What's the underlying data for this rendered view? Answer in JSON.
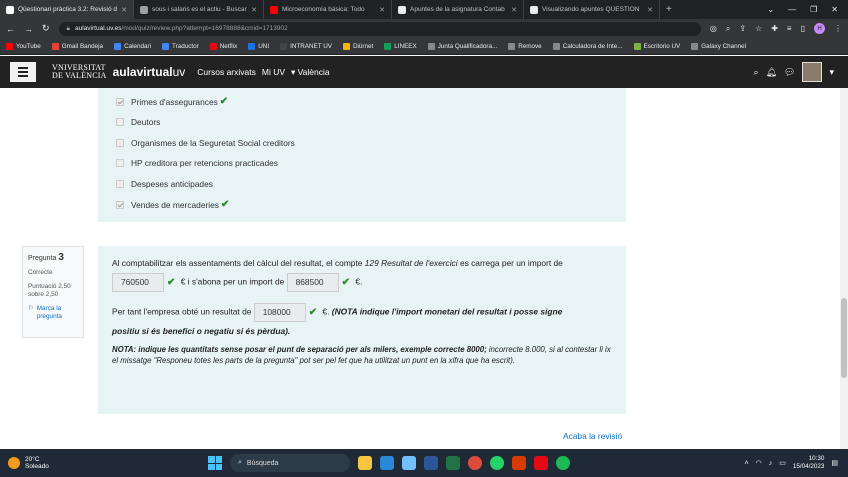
{
  "browser": {
    "tabs": [
      {
        "title": "Qüestionari pràctica 3.2: Revisió d",
        "active": true,
        "color": "#ffffff"
      },
      {
        "title": "sous i salaris es el actiu - Buscar",
        "active": false,
        "color": "#9aa0a6"
      },
      {
        "title": "Microeconomía básica: Todo",
        "active": false,
        "color": "#ff0000"
      },
      {
        "title": "Apuntes de la asignatura Contab",
        "active": false,
        "color": "#e8eaed"
      },
      {
        "title": "Visualizando apuntes QÜESTION",
        "active": false,
        "color": "#e8eaed"
      }
    ],
    "new_tab": "+",
    "window_controls": [
      "⌄",
      "—",
      "❐",
      "✕"
    ],
    "url_host": "aulavirtual.uv.es",
    "url_path": "/mod/quiz/review.php?attempt=16978888&cmid=1713902",
    "profile_initial": "H",
    "bookmarks": [
      {
        "label": "YouTube",
        "color": "#ff0000"
      },
      {
        "label": "Gmail Bandeja",
        "color": "#ea4335"
      },
      {
        "label": "Calendari",
        "color": "#4285f4"
      },
      {
        "label": "Traductor",
        "color": "#4285f4"
      },
      {
        "label": "Netflix",
        "color": "#e50914"
      },
      {
        "label": "UNI",
        "color": "#1a73e8"
      },
      {
        "label": "INTRANET UV",
        "color": "#444444"
      },
      {
        "label": "Diürnet",
        "color": "#f4b400"
      },
      {
        "label": "LINEEX",
        "color": "#0f9d58"
      },
      {
        "label": "Junta Qualificadora...",
        "color": "#888888"
      },
      {
        "label": "Remove",
        "color": "#888888"
      },
      {
        "label": "Calculadora de Inte...",
        "color": "#888888"
      },
      {
        "label": "Escritorio UV",
        "color": "#7cb342"
      },
      {
        "label": "Galaxy Channel",
        "color": "#888888"
      }
    ]
  },
  "site": {
    "logo_line1": "VNIVERSITAT",
    "logo_line2": "DE VALÈNCIA",
    "brand_bold": "aulavirtual",
    "brand_light": "uv",
    "nav": [
      "Cursos arxivats",
      "Mi UV",
      "▾ València"
    ]
  },
  "answers": [
    {
      "label": "Primes d'assegurances",
      "checked": true,
      "correct": true
    },
    {
      "label": "Deutors",
      "checked": false,
      "correct": false
    },
    {
      "label": "Organismes de la Seguretat Social creditors",
      "checked": false,
      "correct": false
    },
    {
      "label": "HP creditora per retencions practicades",
      "checked": false,
      "correct": false
    },
    {
      "label": "Despeses anticipades",
      "checked": false,
      "correct": false
    },
    {
      "label": "Vendes de mercaderies",
      "checked": true,
      "correct": true
    }
  ],
  "tick_glyph": "✔",
  "question": {
    "title_prefix": "Pregunta",
    "number": "3",
    "status": "Correcte",
    "score_line1": "Puntuació 2,50",
    "score_line2": "sobre 2,50",
    "flag_glyph": "⚐",
    "flag_label": "Marca la pregunta",
    "text1_a": "Al comptabilitzar els assentaments del càlcul del resultat, el compte",
    "text1_italic": "129 Resultat de l'exercici",
    "text1_b": "es carrega per un import de",
    "value_debit": "760500",
    "text2_mid": "€ i s'abona per un import de",
    "value_credit": "868500",
    "text2_end": "€.",
    "text3_a": "Per tant l'empresa obté un resultat de",
    "value_result": "108000",
    "text3_euro": "€.",
    "text3_note": "(NOTA indique l'import monetari del resultat i posse signe",
    "text3_note2": "positiu si és benefici o negatiu si és pèrdua).",
    "note_bold": "NOTA: indique les quantitats sense posar el punt de separació per als milers, exemple correcte 8000;",
    "note_rest": "incorrecte 8.000, si al contestar li ix el missatge \"Responeu totes les parts de la pregunta\" pot ser pel fet que ha utilitzat un punt en la xifra que ha escrit)."
  },
  "finish_review": "Acaba la revisió",
  "taskbar": {
    "temp": "20°C",
    "weather": "Soleado",
    "search": "Búsqueda",
    "time": "10:30",
    "date": "15/04/2023",
    "apps": [
      {
        "name": "file-explorer",
        "color": "#f4c542"
      },
      {
        "name": "store",
        "color": "#2b88d8"
      },
      {
        "name": "photos",
        "color": "#74c0ff"
      },
      {
        "name": "word",
        "color": "#2b579a"
      },
      {
        "name": "excel",
        "color": "#217346"
      },
      {
        "name": "chrome",
        "color": "#dd4b39"
      },
      {
        "name": "whatsapp",
        "color": "#25d366"
      },
      {
        "name": "office",
        "color": "#d83b01"
      },
      {
        "name": "netflix",
        "color": "#e50914"
      },
      {
        "name": "spotify",
        "color": "#1db954"
      }
    ]
  }
}
